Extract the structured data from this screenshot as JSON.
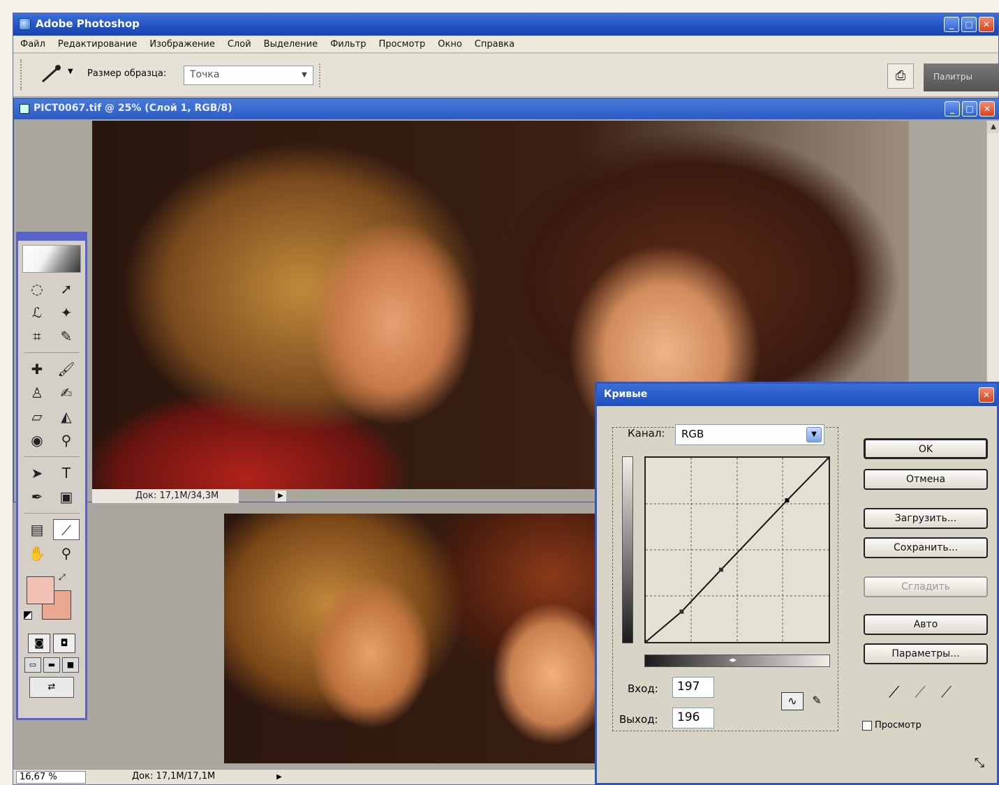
{
  "app": {
    "title": "Adobe Photoshop"
  },
  "menu": [
    "Файл",
    "Редактирование",
    "Изображение",
    "Слой",
    "Выделение",
    "Фильтр",
    "Просмотр",
    "Окно",
    "Справка"
  ],
  "options": {
    "sample_size_label": "Размер образца:",
    "sample_size_value": "Точка",
    "palette_well_label": "Палитры"
  },
  "document": {
    "title": "PICT0067.tif @ 25% (Слой 1, RGB/8)",
    "status_doc": "Док: 17,1M/34,3M"
  },
  "statusbar": {
    "zoom": "16,67 %",
    "doc": "Док: 17,1M/17,1M"
  },
  "toolbox": {
    "tools": [
      "marquee-tool",
      "move-tool",
      "lasso-tool",
      "magic-wand-tool",
      "crop-tool",
      "slice-tool",
      "healing-brush-tool",
      "brush-tool",
      "clone-stamp-tool",
      "history-brush-tool",
      "eraser-tool",
      "paint-bucket-tool",
      "blur-tool",
      "dodge-tool",
      "path-selection-tool",
      "type-tool",
      "pen-tool",
      "shape-tool",
      "notes-tool",
      "eyedropper-tool",
      "hand-tool",
      "zoom-tool"
    ],
    "colors": {
      "foreground": "#f2c2b6",
      "background": "#e9a88f"
    }
  },
  "curves": {
    "title": "Кривые",
    "channel_label": "Канал:",
    "channel_value": "RGB",
    "input_label": "Вход:",
    "input_value": "197",
    "output_label": "Выход:",
    "output_value": "196",
    "buttons": {
      "ok": "OK",
      "cancel": "Отмена",
      "load": "Загрузить...",
      "save": "Сохранить...",
      "smooth": "Сгладить",
      "auto": "Авто",
      "options": "Параметры..."
    },
    "preview_label": "Просмотр",
    "preview_checked": false,
    "curve_points": [
      [
        0,
        0
      ],
      [
        50,
        42
      ],
      [
        105,
        100
      ],
      [
        197,
        196
      ],
      [
        255,
        255
      ]
    ]
  }
}
